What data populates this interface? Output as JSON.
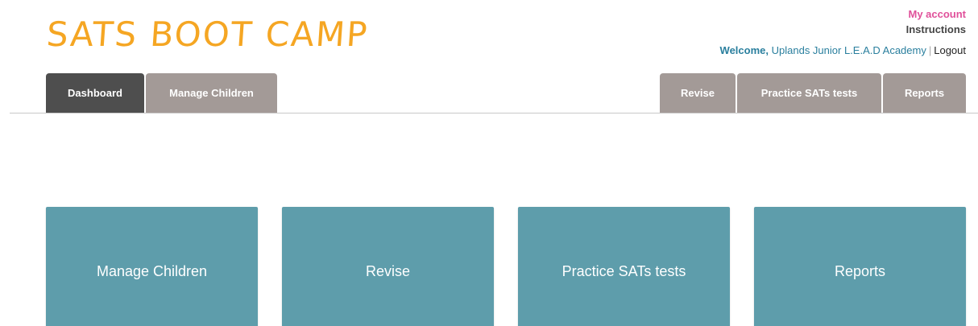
{
  "header": {
    "logo_text": "SATS BOOT CAMP",
    "my_account": "My account",
    "instructions": "Instructions",
    "welcome_label": "Welcome,",
    "school_name": "Uplands Junior L.E.A.D Academy",
    "separator": "|",
    "logout": "Logout"
  },
  "nav": {
    "left_tabs": [
      {
        "label": "Dashboard",
        "active": true
      },
      {
        "label": "Manage Children",
        "active": false
      }
    ],
    "right_tabs": [
      {
        "label": "Revise"
      },
      {
        "label": "Practice SATs tests"
      },
      {
        "label": "Reports"
      }
    ]
  },
  "dashboard": {
    "cards": [
      {
        "label": "Manage Children"
      },
      {
        "label": "Revise"
      },
      {
        "label": "Practice SATs tests"
      },
      {
        "label": "Reports"
      }
    ]
  },
  "colors": {
    "logo": "#f5a623",
    "my_account": "#e0509a",
    "welcome": "#2a7f9e",
    "tab_active": "#4e4e4e",
    "tab_inactive": "#a39a97",
    "card": "#5e9dab"
  }
}
